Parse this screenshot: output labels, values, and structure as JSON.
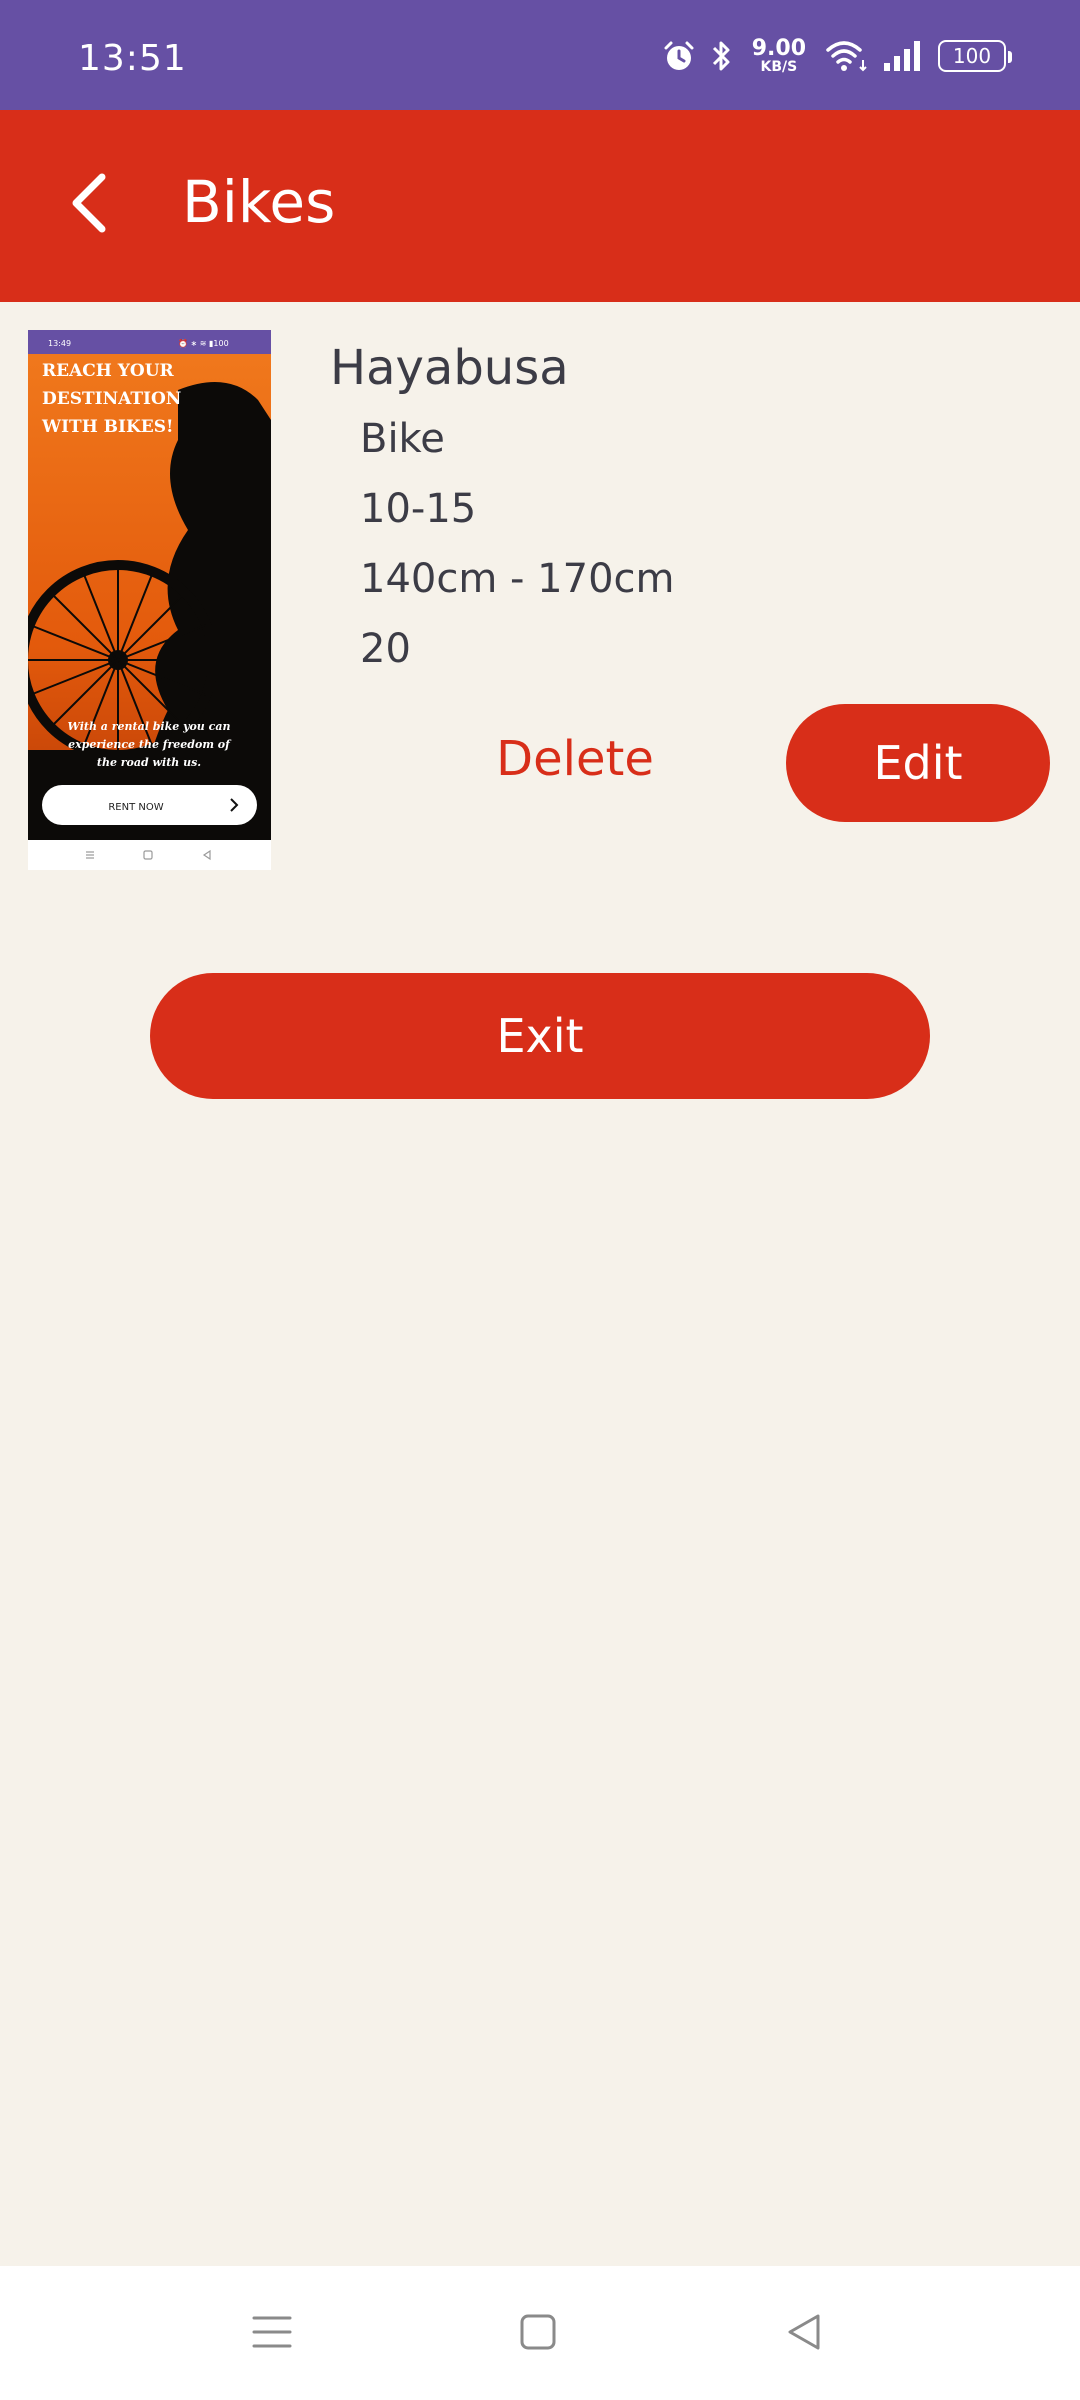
{
  "status_bar": {
    "time": "13:51",
    "net_speed_value": "9.00",
    "net_speed_unit": "KB/S",
    "battery_level": "100",
    "icons": [
      "alarm-icon",
      "bluetooth-icon",
      "wifi-icon",
      "signal-icon",
      "battery-icon"
    ]
  },
  "app_bar": {
    "title": "Bikes",
    "back_icon": "chevron-left-icon"
  },
  "bike": {
    "name": "Hayabusa",
    "type": "Bike",
    "age_range": "10-15",
    "height_range": "140cm - 170cm",
    "price": "20",
    "delete_label": "Delete",
    "edit_label": "Edit",
    "thumbnail": {
      "status_time": "13:49",
      "headline_1": "REACH YOUR",
      "headline_2": "DESTINATION",
      "headline_3": "WITH BIKES!",
      "tagline_1": "With a rental bike you can",
      "tagline_2": "experience the freedom of",
      "tagline_3": "the road with us.",
      "cta_label": "RENT NOW"
    }
  },
  "exit_label": "Exit",
  "nav_bar": {
    "icons": [
      "menu-icon",
      "home-square-icon",
      "back-triangle-icon"
    ]
  },
  "colors": {
    "status_bar": "#6650a4",
    "primary": "#d82e19",
    "background": "#f6f2ea",
    "text": "#3c3c46"
  }
}
